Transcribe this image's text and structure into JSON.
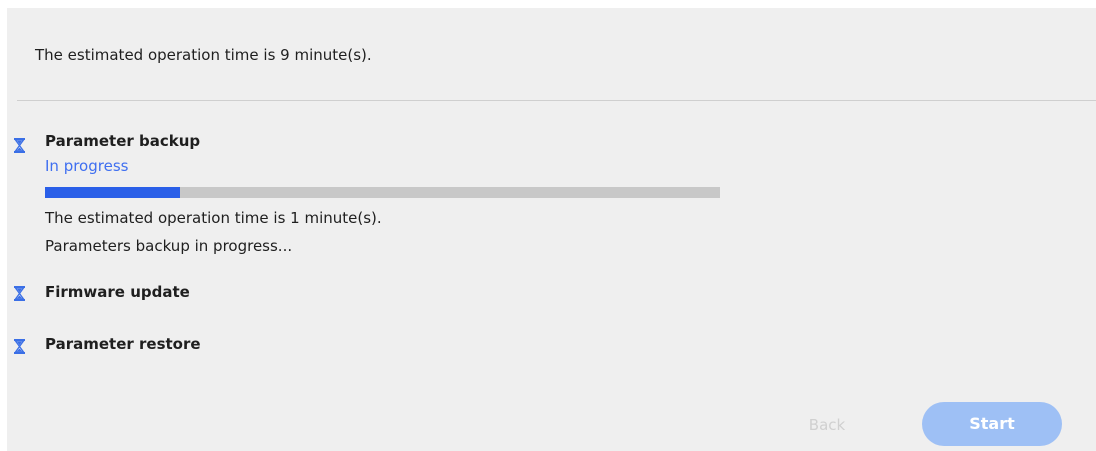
{
  "summary": {
    "estimated_time": "The estimated operation time is 9 minute(s)."
  },
  "steps": [
    {
      "title": "Parameter backup",
      "status": "In progress",
      "progress_fraction": 0.2,
      "details": [
        "The estimated operation time is 1 minute(s).",
        "Parameters backup in progress..."
      ]
    },
    {
      "title": "Firmware update"
    },
    {
      "title": "Parameter restore"
    }
  ],
  "buttons": {
    "back_label": "Back",
    "start_label": "Start"
  },
  "icons": {
    "step_icon": "hourglass-icon"
  },
  "colors": {
    "accent": "#2a5fe8",
    "status_text": "#3f6ff0",
    "track": "#c8c8c8",
    "start_button_disabled": "#9ec0f5",
    "back_button_disabled": "#d0d0d0"
  }
}
